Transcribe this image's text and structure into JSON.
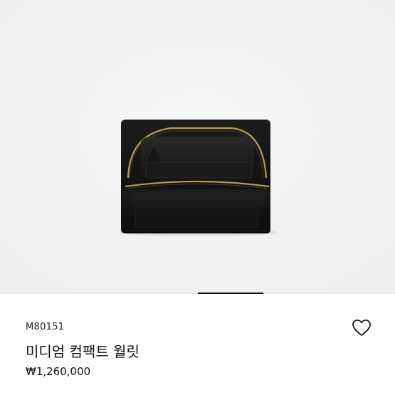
{
  "product": {
    "sku": "M80151",
    "name": "미디엄 컴팩트 월릿",
    "price": "₩1,260,000"
  },
  "gallery": {
    "image_alt": "wallet-product-image",
    "active_index": 1,
    "total": 3
  },
  "icons": {
    "wishlist": "heart-outline-icon"
  },
  "colors": {
    "background": "#ffffff",
    "image_bg": "#f4f4f4",
    "text": "#111111",
    "wallet": "#111111",
    "zipper": "#b89a55"
  }
}
